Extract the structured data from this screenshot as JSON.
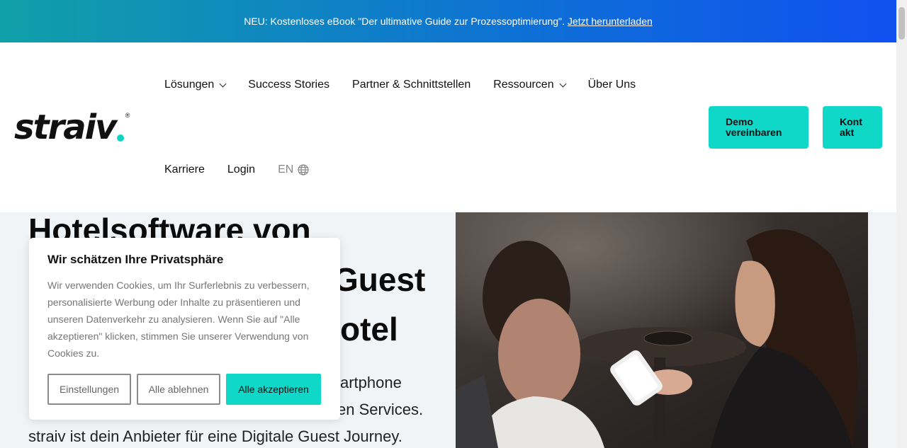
{
  "announcement": {
    "text": "NEU: Kostenloses eBook \"Der ultimative Guide zur Prozessoptimierung\".",
    "link": "Jetzt herunterladen"
  },
  "brand": {
    "logo_text": "straiv",
    "registered_mark": "®",
    "accent_color": "#0fd8c8"
  },
  "nav": {
    "row1": [
      {
        "label": "Lösungen",
        "dropdown": true
      },
      {
        "label": "Success Stories",
        "dropdown": false
      },
      {
        "label": "Partner & Schnittstellen",
        "dropdown": false
      },
      {
        "label": "Ressourcen",
        "dropdown": true
      },
      {
        "label": "Über Uns",
        "dropdown": false
      }
    ],
    "row2": [
      {
        "label": "Karriere"
      },
      {
        "label": "Login"
      }
    ],
    "language": "EN"
  },
  "cta": {
    "demo_line1": "Demo",
    "demo_line2": "vereinbaren",
    "kontakt_line1": "Kont",
    "kontakt_line2": "akt"
  },
  "hero": {
    "title_line1": "Hotelsoftware von",
    "title_line2": "Guest",
    "title_line3": "otel",
    "text_line1": "artphone",
    "text_line2": "en Services.",
    "text_line3": "straiv ist dein Anbieter für eine Digitale Guest Journey."
  },
  "cookie": {
    "title": "Wir schätzen Ihre Privatsphäre",
    "body": "Wir verwenden Cookies, um Ihr Surferlebnis zu verbessern, personalisierte Werbung oder Inhalte zu präsentieren und unseren Datenverkehr zu analysieren. Wenn Sie auf \"Alle akzeptieren\" klicken, stimmen Sie unserer Verwendung von Cookies zu.",
    "settings": "Einstellungen",
    "reject": "Alle ablehnen",
    "accept": "Alle akzeptieren"
  }
}
